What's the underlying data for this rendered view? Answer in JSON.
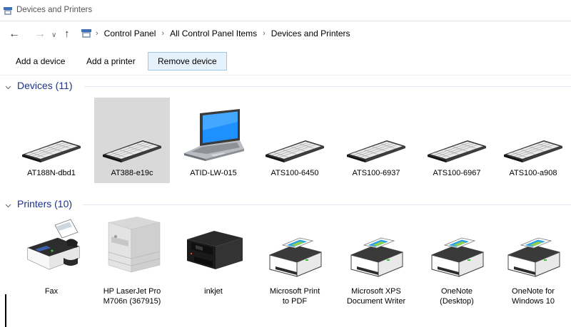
{
  "window": {
    "title": "Devices and Printers"
  },
  "address": {
    "breadcrumbs": [
      "Control Panel",
      "All Control Panel Items",
      "Devices and Printers"
    ]
  },
  "toolbar": {
    "add_device": "Add a device",
    "add_printer": "Add a printer",
    "remove_device": "Remove device"
  },
  "devices": {
    "header": "Devices (11)",
    "items": [
      {
        "label": "AT188N-dbd1",
        "icon": "keyboard-icon"
      },
      {
        "label": "AT388-e19c",
        "icon": "keyboard-icon",
        "selected": true
      },
      {
        "label": "ATID-LW-015",
        "icon": "laptop-icon"
      },
      {
        "label": "ATS100-6450",
        "icon": "keyboard-icon"
      },
      {
        "label": "ATS100-6937",
        "icon": "keyboard-icon"
      },
      {
        "label": "ATS100-6967",
        "icon": "keyboard-icon"
      },
      {
        "label": "ATS100-a908",
        "icon": "keyboard-icon"
      }
    ]
  },
  "printers": {
    "header": "Printers (10)",
    "items": [
      {
        "label": "Fax",
        "icon": "fax-icon"
      },
      {
        "label_line1": "HP LaserJet Pro",
        "label_line2": "M706n (367915)",
        "icon": "laser-printer-icon"
      },
      {
        "label": "inkjet",
        "icon": "inkjet-printer-icon"
      },
      {
        "label_line1": "Microsoft Print",
        "label_line2": "to PDF",
        "icon": "virtual-printer-icon"
      },
      {
        "label_line1": "Microsoft XPS",
        "label_line2": "Document Writer",
        "icon": "virtual-printer-icon"
      },
      {
        "label_line1": "OneNote",
        "label_line2": "(Desktop)",
        "icon": "virtual-printer-icon"
      },
      {
        "label_line1": "OneNote for",
        "label_line2": "Windows 10",
        "icon": "virtual-printer-icon"
      }
    ]
  },
  "colors": {
    "accent": "#1e3287",
    "selected_tile": "#d9d9d9",
    "button_hover_bg": "#e5f1fb",
    "button_hover_border": "#99c9ef"
  }
}
